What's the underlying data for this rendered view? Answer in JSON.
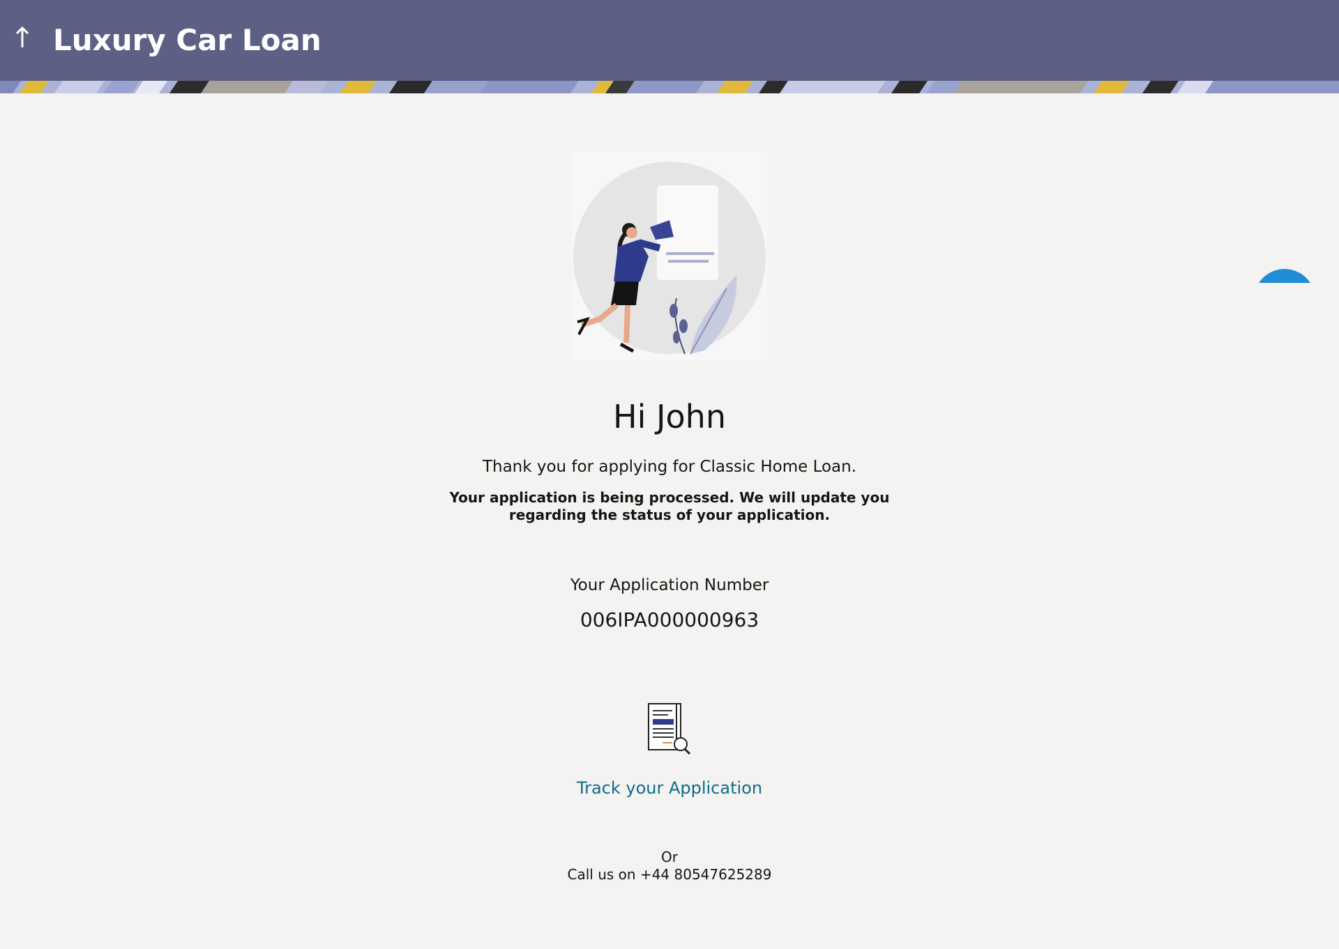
{
  "header": {
    "title": "Luxury Car Loan",
    "back_icon": "arrow-up-icon"
  },
  "main": {
    "illustration": "woman-with-megaphone-illustration",
    "greeting": "Hi John",
    "thanks_message": "Thank you for applying for Classic Home Loan.",
    "processing_message": "Your application is being processed. We will update you regarding the status of your application.",
    "application_number_label": "Your Application Number",
    "application_number": "006IPA000000963",
    "track_icon": "document-search-icon",
    "track_link": "Track your Application",
    "or_text": "Or",
    "call_text": "Call us on +44 80547625289"
  },
  "colors": {
    "header_bg": "#5b6084",
    "page_bg": "#f4f3f1",
    "link": "#0e6b8c",
    "fab": "#1e8ed6"
  }
}
